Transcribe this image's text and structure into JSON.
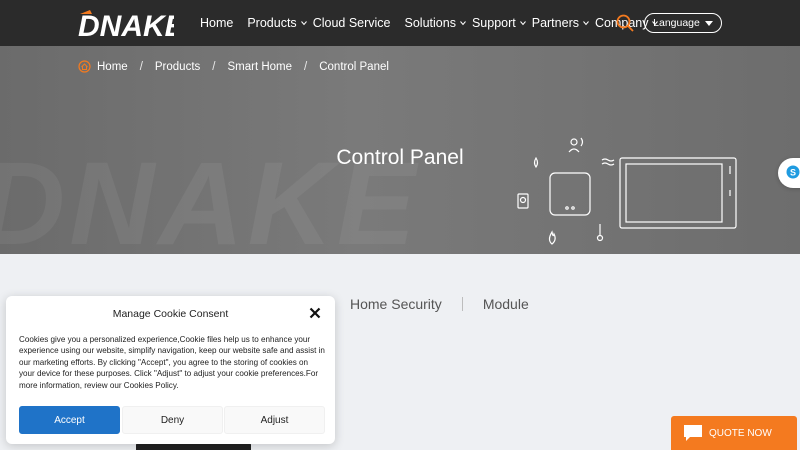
{
  "brand": {
    "logo_text": "DNAKE",
    "accent_color": "#f47a1f"
  },
  "nav": {
    "items": [
      {
        "label": "Home",
        "has_dropdown": false
      },
      {
        "label": "Products",
        "has_dropdown": true
      },
      {
        "label": "Cloud Service",
        "has_dropdown": false
      },
      {
        "label": "Solutions",
        "has_dropdown": true
      },
      {
        "label": "Support",
        "has_dropdown": true
      },
      {
        "label": "Partners",
        "has_dropdown": true
      },
      {
        "label": "Company",
        "has_dropdown": true
      }
    ],
    "search_icon": "search-icon",
    "language_label": "Language"
  },
  "hero": {
    "breadcrumb": [
      "Home",
      "Products",
      "Smart Home",
      "Control Panel"
    ],
    "title": "Control Panel",
    "watermark": "DNAKE"
  },
  "tabs": [
    {
      "label": "Home Security"
    },
    {
      "label": "Module"
    }
  ],
  "cookie": {
    "title": "Manage Cookie Consent",
    "body": "Cookies give you a personalized experience,Cookie files help us to enhance your experience using our website, simplify navigation, keep our website safe and assist in our marketing efforts. By clicking \"Accept\", you agree to the storing of cookies on your device for these purposes. Click \"Adjust\" to adjust your cookie preferences.For more information, review our Cookies Policy.",
    "accept_label": "Accept",
    "deny_label": "Deny",
    "adjust_label": "Adjust",
    "accept_color": "#1f73c8"
  },
  "quote": {
    "label": "QUOTE NOW",
    "icon": "chat-icon"
  },
  "side_widget": {
    "icon": "skype-icon"
  }
}
